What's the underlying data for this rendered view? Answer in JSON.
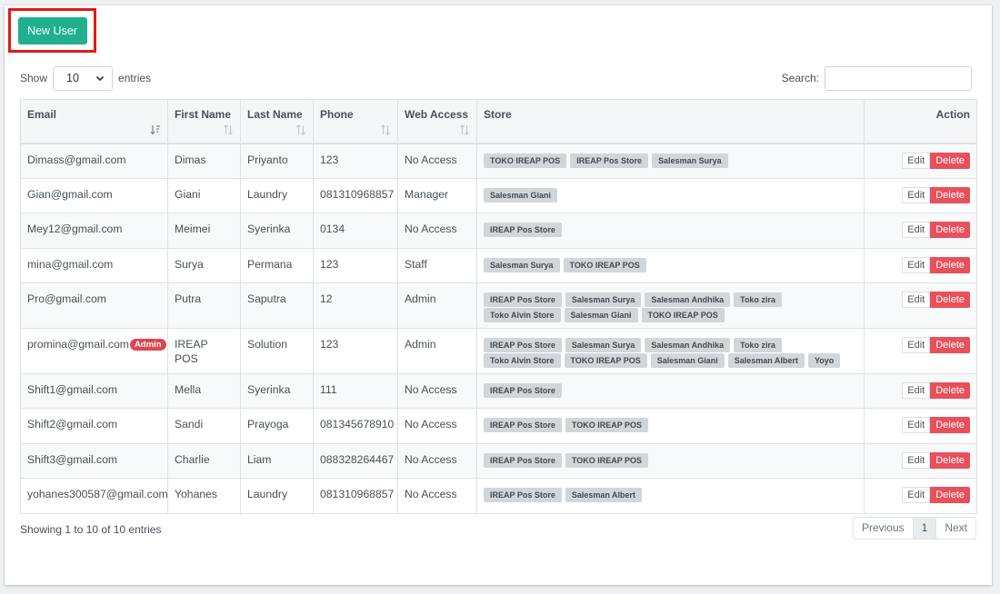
{
  "toolbar": {
    "new_user_label": "New User"
  },
  "length": {
    "show": "Show",
    "value": "10",
    "entries": "entries"
  },
  "search": {
    "label": "Search:",
    "placeholder": ""
  },
  "table": {
    "headers": [
      "Email",
      "First Name",
      "Last Name",
      "Phone",
      "Web Access",
      "Store",
      "Action"
    ],
    "rows": [
      {
        "email": "Dimass@gmail.com",
        "first": "Dimas",
        "last": "Priyanto",
        "phone": "123",
        "access": "No Access",
        "stores": [
          "TOKO IREAP POS",
          "IREAP Pos Store",
          "Salesman Surya"
        ]
      },
      {
        "email": "Gian@gmail.com",
        "first": "Giani",
        "last": "Laundry",
        "phone": "081310968857",
        "access": "Manager",
        "stores": [
          "Salesman Giani"
        ]
      },
      {
        "email": "Mey12@gmail.com",
        "first": "Meimei",
        "last": "Syerinka",
        "phone": "0134",
        "access": "No Access",
        "stores": [
          "IREAP Pos Store"
        ]
      },
      {
        "email": "mina@gmail.com",
        "first": "Surya",
        "last": "Permana",
        "phone": "123",
        "access": "Staff",
        "stores": [
          "Salesman Surya",
          "TOKO IREAP POS"
        ]
      },
      {
        "email": "Pro@gmail.com",
        "first": "Putra",
        "last": "Saputra",
        "phone": "12",
        "access": "Admin",
        "stores": [
          "IREAP Pos Store",
          "Salesman Surya",
          "Salesman Andhika",
          "Toko zira",
          "Toko Alvin Store",
          "Salesman Giani",
          "TOKO IREAP POS"
        ]
      },
      {
        "email": "promina@gmail.com",
        "badge": "Admin",
        "first": "IREAP POS",
        "last": "Solution",
        "phone": "123",
        "access": "Admin",
        "stores": [
          "IREAP Pos Store",
          "Salesman Surya",
          "Salesman Andhika",
          "Toko zira",
          "Toko Alvin Store",
          "TOKO IREAP POS",
          "Salesman Giani",
          "Salesman Albert",
          "Yoyo"
        ]
      },
      {
        "email": "Shift1@gmail.com",
        "first": "Mella",
        "last": "Syerinka",
        "phone": "111",
        "access": "No Access",
        "stores": [
          "IREAP Pos Store"
        ]
      },
      {
        "email": "Shift2@gmail.com",
        "first": "Sandi",
        "last": "Prayoga",
        "phone": "081345678910",
        "access": "No Access",
        "stores": [
          "IREAP Pos Store",
          "TOKO IREAP POS"
        ]
      },
      {
        "email": "Shift3@gmail.com",
        "first": "Charlie",
        "last": "Liam",
        "phone": "088328264467",
        "access": "No Access",
        "stores": [
          "IREAP Pos Store",
          "TOKO IREAP POS"
        ]
      },
      {
        "email": "yohanes300587@gmail.com",
        "first": "Yohanes",
        "last": "Laundry",
        "phone": "081310968857",
        "access": "No Access",
        "stores": [
          "IREAP Pos Store",
          "Salesman Albert"
        ]
      }
    ],
    "edit_label": "Edit",
    "delete_label": "Delete"
  },
  "footer": {
    "info": "Showing 1 to 10 of 10 entries"
  },
  "pagination": {
    "previous": "Previous",
    "page": "1",
    "next": "Next"
  },
  "colors": {
    "primary": "#20b08f",
    "danger": "#e8505b",
    "highlight": "#e21919"
  }
}
